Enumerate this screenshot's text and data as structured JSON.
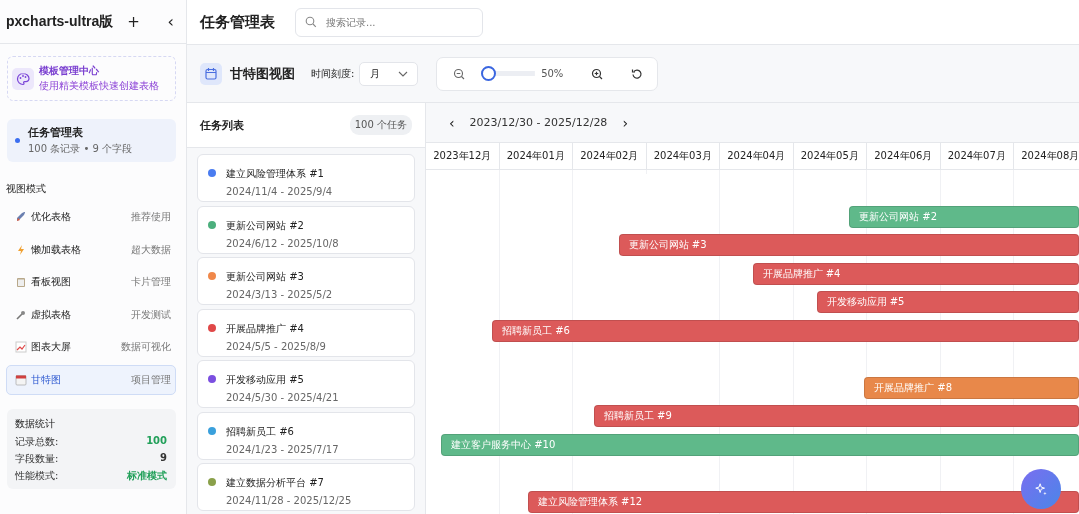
{
  "sidebar": {
    "app_title": "pxcharts-ultra版",
    "add_label": "+",
    "collapse_label": "‹",
    "template_card": {
      "title": "模板管理中心",
      "subtitle": "使用精美模板快速创建表格"
    },
    "table_card": {
      "name": "任务管理表",
      "meta": "100 条记录 • 9 个字段",
      "selected": true
    },
    "views_heading": "视图模式",
    "views": [
      {
        "label": "优化表格",
        "hint": "推荐使用",
        "selected": false
      },
      {
        "label": "懒加载表格",
        "hint": "超大数据",
        "selected": false
      },
      {
        "label": "看板视图",
        "hint": "卡片管理",
        "selected": false
      },
      {
        "label": "虚拟表格",
        "hint": "开发测试",
        "selected": false
      },
      {
        "label": "图表大屏",
        "hint": "数据可视化",
        "selected": false
      },
      {
        "label": "甘特图",
        "hint": "项目管理",
        "selected": true
      }
    ],
    "stats": {
      "title": "数据统计",
      "rows": [
        {
          "label": "记录总数:",
          "value": "100",
          "color": "#22a05a"
        },
        {
          "label": "字段数量:",
          "value": "9",
          "color": "#333333"
        },
        {
          "label": "性能模式:",
          "value": "标准模式",
          "color": "#22a05a"
        }
      ]
    }
  },
  "header": {
    "title": "任务管理表",
    "search_placeholder": "搜索记录..."
  },
  "toolbar": {
    "view_title": "甘特图视图",
    "scale_label": "时间刻度:",
    "scale_value": "月",
    "zoom": {
      "level": 0,
      "reading": "50%"
    }
  },
  "task_list": {
    "title": "任务列表",
    "count": "100 个任务",
    "tasks": [
      {
        "name": "建立风险管理体系 #1",
        "dates": "2024/11/4 - 2025/9/4",
        "color": "#4a7cf0"
      },
      {
        "name": "更新公司网站 #2",
        "dates": "2024/6/12 - 2025/10/8",
        "color": "#4caf7d"
      },
      {
        "name": "更新公司网站 #3",
        "dates": "2024/3/13 - 2025/5/2",
        "color": "#f0884a"
      },
      {
        "name": "开展品牌推广 #4",
        "dates": "2024/5/5 - 2025/8/9",
        "color": "#e04848"
      },
      {
        "name": "开发移动应用 #5",
        "dates": "2024/5/30 - 2025/4/21",
        "color": "#7b4fe0"
      },
      {
        "name": "招聘新员工 #6",
        "dates": "2024/1/23 - 2025/7/17",
        "color": "#3aa0dc"
      },
      {
        "name": "建立数据分析平台 #7",
        "dates": "2024/11/28 - 2025/12/25",
        "color": "#8aa04a"
      }
    ]
  },
  "timeline": {
    "range": "2023/12/30 - 2025/12/28",
    "prev_label": "‹",
    "next_label": "›",
    "months": [
      "2023年12月",
      "2024年01月",
      "2024年02月",
      "2024年03月",
      "2024年04月",
      "2024年05月",
      "2024年06月",
      "2024年07月",
      "2024年08月"
    ],
    "rows": [
      {
        "kind": "empty"
      },
      {
        "kind": "bar",
        "label": "更新公司网站 #2",
        "level": 0.352,
        "color": "#5fb98a"
      },
      {
        "kind": "bar",
        "label": "更新公司网站 #3",
        "level": 0.705,
        "color": "#dc5a5a"
      },
      {
        "kind": "bar",
        "label": "开展品牌推广 #4",
        "level": 0.5,
        "color": "#dc5a5a"
      },
      {
        "kind": "bar",
        "label": "开发移动应用 #5",
        "level": 0.402,
        "color": "#dc5a5a"
      },
      {
        "kind": "bar",
        "label": "招聘新员工 #6",
        "level": 0.899,
        "color": "#dc5a5a"
      },
      {
        "kind": "empty"
      },
      {
        "kind": "bar",
        "label": "开展品牌推广 #8",
        "level": 0.329,
        "color": "#e8884a"
      },
      {
        "kind": "bar",
        "label": "招聘新员工 #9",
        "level": 0.743,
        "color": "#dc5a5a"
      },
      {
        "kind": "bar",
        "label": "建立客户服务中心 #10",
        "level": 0.977,
        "color": "#5fb98a"
      },
      {
        "kind": "empty"
      },
      {
        "kind": "bar",
        "label": "建立风险管理体系 #12",
        "level": 0.844,
        "color": "#dc5a5a"
      }
    ]
  }
}
